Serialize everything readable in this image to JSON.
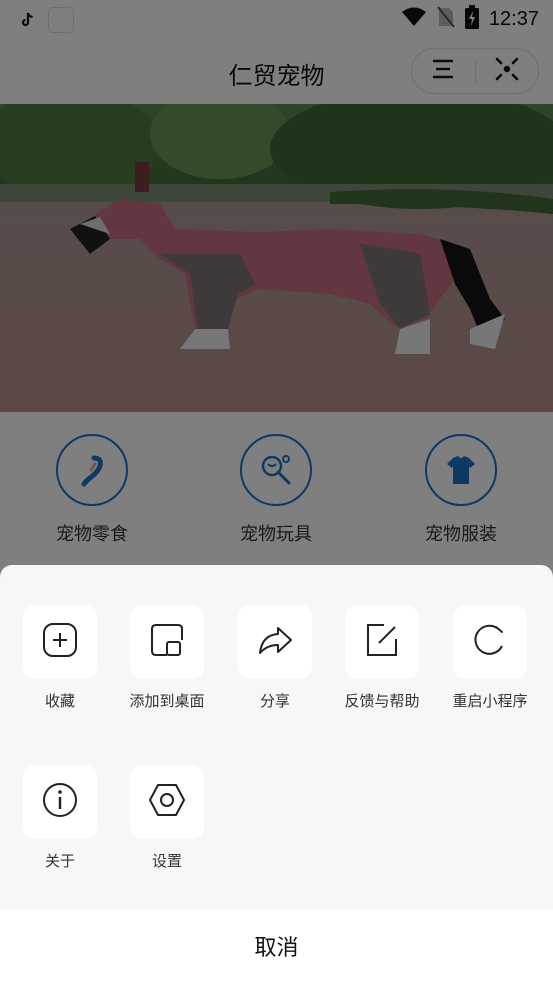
{
  "status_bar": {
    "time": "12:37",
    "icons": [
      "tiktok-icon",
      "app-icon",
      "wifi-icon",
      "no-sim-icon",
      "battery-charging-icon"
    ]
  },
  "navbar": {
    "title": "仁贸宠物",
    "menu_icon": "menu-icon",
    "close_icon": "close-target-icon"
  },
  "banner": {
    "image": "dog-in-pink-raincoat-photo"
  },
  "categories": [
    {
      "label": "宠物零食",
      "icon": "treat-icon"
    },
    {
      "label": "宠物玩具",
      "icon": "toy-icon"
    },
    {
      "label": "宠物服装",
      "icon": "clothing-icon"
    }
  ],
  "action_sheet": {
    "actions": [
      {
        "label": "收藏",
        "icon": "plus-square-icon"
      },
      {
        "label": "添加到桌面",
        "icon": "add-to-desktop-icon"
      },
      {
        "label": "分享",
        "icon": "share-icon"
      },
      {
        "label": "反馈与帮助",
        "icon": "feedback-icon"
      },
      {
        "label": "重启小程序",
        "icon": "restart-icon"
      },
      {
        "label": "关于",
        "icon": "info-icon"
      },
      {
        "label": "设置",
        "icon": "settings-hexagon-icon"
      }
    ],
    "cancel_label": "取消"
  },
  "colors": {
    "accent_blue": "#1a73c9",
    "mask": "rgba(0,0,0,0.5)",
    "sheet_bg": "#f7f7f7",
    "tile_bg": "#ffffff"
  }
}
